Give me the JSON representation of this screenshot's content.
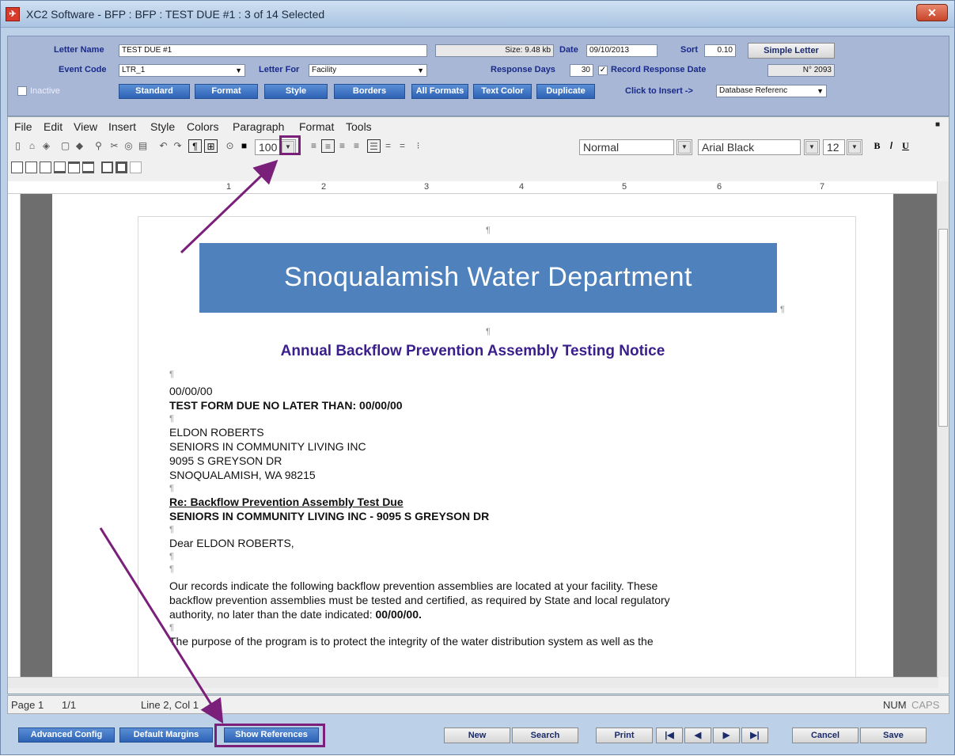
{
  "window": {
    "title": "XC2 Software - BFP : BFP : TEST DUE #1 : 3 of 14 Selected"
  },
  "header": {
    "letter_name_label": "Letter Name",
    "letter_name_value": "TEST DUE #1",
    "size_text": "Size: 9.48 kb",
    "date_label": "Date",
    "date_value": "09/10/2013",
    "sort_label": "Sort",
    "sort_value": "0.10",
    "simple_letter_btn": "Simple Letter",
    "event_code_label": "Event Code",
    "event_code_value": "LTR_1",
    "letter_for_label": "Letter For",
    "letter_for_value": "Facility",
    "response_days_label": "Response Days",
    "response_days_value": "30",
    "record_response_label": "Record Response Date",
    "record_response_checked": "✓",
    "record_number": "N° 2093",
    "inactive_label": "Inactive",
    "format_buttons": [
      "Standard",
      "Format",
      "Style",
      "Borders",
      "All Formats",
      "Text Color",
      "Duplicate"
    ],
    "click_to_insert_label": "Click to Insert ->",
    "insert_select_value": "Database Referenc"
  },
  "menu": [
    "File",
    "Edit",
    "View",
    "Insert",
    "Style",
    "Colors",
    "Paragraph",
    "Format",
    "Tools"
  ],
  "toolbar": {
    "zoom_value": "100",
    "style_value": "Normal",
    "font_value": "Arial Black",
    "size_value": "12",
    "bold_label": "B",
    "italic_label": "/",
    "underline_label": "U"
  },
  "ruler": {
    "numbers": [
      "1",
      "2",
      "3",
      "4",
      "5",
      "6",
      "7"
    ]
  },
  "document": {
    "banner": "Snoqualamish Water Department",
    "title": "Annual Backflow Prevention Assembly Testing Notice",
    "lines": [
      "00/00/00",
      "TEST FORM DUE NO LATER THAN: 00/00/00",
      "ELDON ROBERTS",
      "SENIORS IN COMMUNITY LIVING INC",
      "9095 S GREYSON DR",
      "SNOQUALAMISH, WA  98215",
      "Re: Backflow Prevention Assembly Test Due",
      "SENIORS IN COMMUNITY LIVING INC - 9095 S GREYSON DR",
      "Dear ELDON ROBERTS,",
      "Our records indicate the following backflow prevention assemblies are located at your facility.  These",
      "backflow prevention assemblies must be tested and certified, as required by State and local regulatory",
      "authority, no later than the date indicated: ",
      "00/00/00.",
      "The purpose of the program is to protect the integrity of the water distribution system as well as the"
    ],
    "pilcrow": "¶"
  },
  "statusbar": {
    "page": "Page 1",
    "page_of": "1/1",
    "position": "Line 2, Col 1",
    "num": "NUM",
    "caps": "CAPS"
  },
  "footer": {
    "advanced_config": "Advanced Config",
    "default_margins": "Default Margins",
    "show_references": "Show References",
    "new": "New",
    "search": "Search",
    "print": "Print",
    "first": "|◀",
    "prev": "◀",
    "next": "▶",
    "last": "▶|",
    "cancel": "Cancel",
    "save": "Save"
  },
  "colors": {
    "annotation": "#7a1f7a",
    "banner": "#4f81bd",
    "title": "#3a1e8c"
  }
}
